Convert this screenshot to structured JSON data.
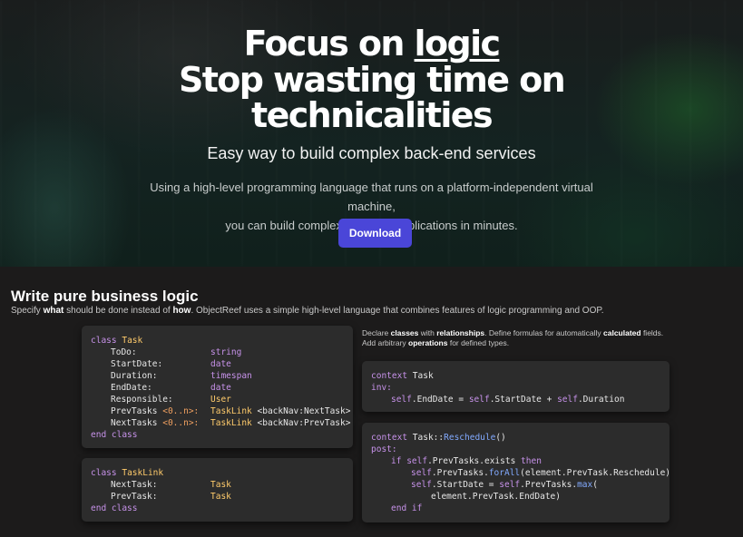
{
  "hero": {
    "headline_focus": "Focus on ",
    "headline_logic": "logic",
    "headline_line2": "Stop wasting time on",
    "headline_line3": "technicalities",
    "subtitle": "Easy way to build complex back-end services",
    "description_line1": "Using a high-level programming language that runs on a platform-independent virtual machine,",
    "description_line2": "you can build complex business applications in minutes.",
    "download_label": "Download"
  },
  "section": {
    "title": "Write pure business logic",
    "desc_specify": "Specify ",
    "desc_what": "what",
    "desc_mid": " should be done instead of ",
    "desc_how": "how",
    "desc_rest": ". ObjectReef uses a simple high-level language that combines features of logic programming and OOP.",
    "side_declare": "Declare ",
    "side_classes": "classes",
    "side_with": " with ",
    "side_relationships": "relationships",
    "side_define": ". Define formulas for automatically ",
    "side_calculated": "calculated",
    "side_fields": " fields.",
    "side_add": "Add arbitrary ",
    "side_operations": "operations",
    "side_types": " for defined types."
  },
  "code_task": {
    "open_kw": "class",
    "name": "Task",
    "fields": [
      {
        "name": "ToDo:",
        "type": "string",
        "kind": "plain"
      },
      {
        "name": "StartDate:",
        "type": "date",
        "kind": "plain"
      },
      {
        "name": "Duration:",
        "type": "timespan",
        "kind": "plain"
      },
      {
        "name": "EndDate:",
        "type": "date",
        "kind": "plain"
      },
      {
        "name": "Responsible:",
        "type": "User",
        "kind": "plain"
      }
    ],
    "prev_name": "PrevTasks",
    "prev_mult": "<0..n>:",
    "prev_type": "TaskLink",
    "prev_nav": "<backNav:NextTask>",
    "next_name": "NextTasks",
    "next_mult": "<0..n>:",
    "next_type": "TaskLink",
    "next_nav": "<backNav:PrevTask>",
    "close": "end class"
  },
  "code_tasklink": {
    "open_kw": "class",
    "name": "TaskLink",
    "field1_name": "NextTask:",
    "field1_type": "Task",
    "field2_name": "PrevTask:",
    "field2_type": "Task",
    "close": "end class"
  },
  "code_context1": {
    "kw": "context",
    "name": "Task",
    "inv": "inv:",
    "self1": "self",
    "body1": ".EndDate = ",
    "self2": "self",
    "body2": ".StartDate + ",
    "self3": "self",
    "body3": ".Duration"
  },
  "code_context2": {
    "kw": "context",
    "name": "Task",
    "sep": "::",
    "op": "Reschedule",
    "parens": "()",
    "post": "post:",
    "if": "if",
    "self": "self",
    "l3_body": ".PrevTasks.exists",
    "then": "then",
    "l4_body": ".PrevTasks.",
    "forAll": "forAll",
    "l4_rest": "(element.PrevTask.Reschedule)",
    "l5_mid": ".StartDate = ",
    "l5_body": ".PrevTasks.",
    "max": "max",
    "l5_paren": "(",
    "l6_body": "element.PrevTask.EndDate)",
    "end_if": "end if"
  }
}
